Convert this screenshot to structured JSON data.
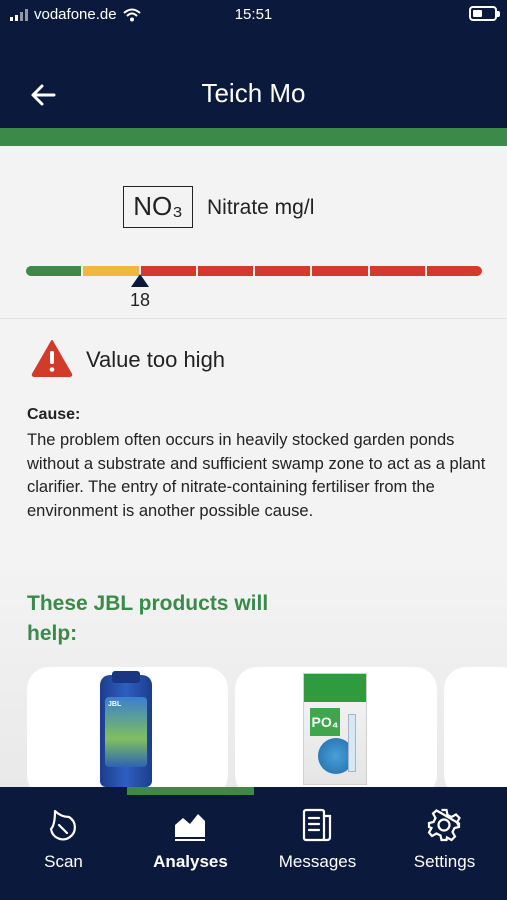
{
  "status_bar": {
    "carrier": "vodafone.de",
    "time": "15:51"
  },
  "header": {
    "title": "Teich Mo"
  },
  "parameter": {
    "symbol": "NO₃",
    "name": "Nitrate mg/l",
    "value": "18",
    "value_numeric": 18,
    "scale_colors": [
      "#3b8a49",
      "#f2b640",
      "#d23a2a",
      "#d23a2a",
      "#d23a2a",
      "#d23a2a",
      "#d23a2a",
      "#d23a2a"
    ]
  },
  "warning": {
    "title": "Value too high",
    "cause_label": "Cause:",
    "cause_text": "The problem often occurs in heavily stocked garden ponds without a substrate and sufficient swamp zone to act as a plant clarifier. The entry of nitrate-containing fertiliser from the environment is another possible cause.",
    "icon_color": "#d23a2a"
  },
  "products": {
    "title": "These JBL products will help:",
    "items": [
      {
        "brand_text": "JBL",
        "icon": "conditioner-bottle-image"
      },
      {
        "brand_text": "PO₄",
        "icon": "aquatest-kit-image"
      },
      {
        "icon": "product-card-partial"
      }
    ]
  },
  "tabs": [
    {
      "label": "Scan",
      "icon": "drop-icon",
      "active": false
    },
    {
      "label": "Analyses",
      "icon": "chart-icon",
      "active": true
    },
    {
      "label": "Messages",
      "icon": "document-icon",
      "active": false
    },
    {
      "label": "Settings",
      "icon": "gear-icon",
      "active": false
    }
  ],
  "colors": {
    "navy": "#0b1a3c",
    "green": "#3b8a49",
    "red": "#d23a2a",
    "yellow": "#f2b640"
  }
}
